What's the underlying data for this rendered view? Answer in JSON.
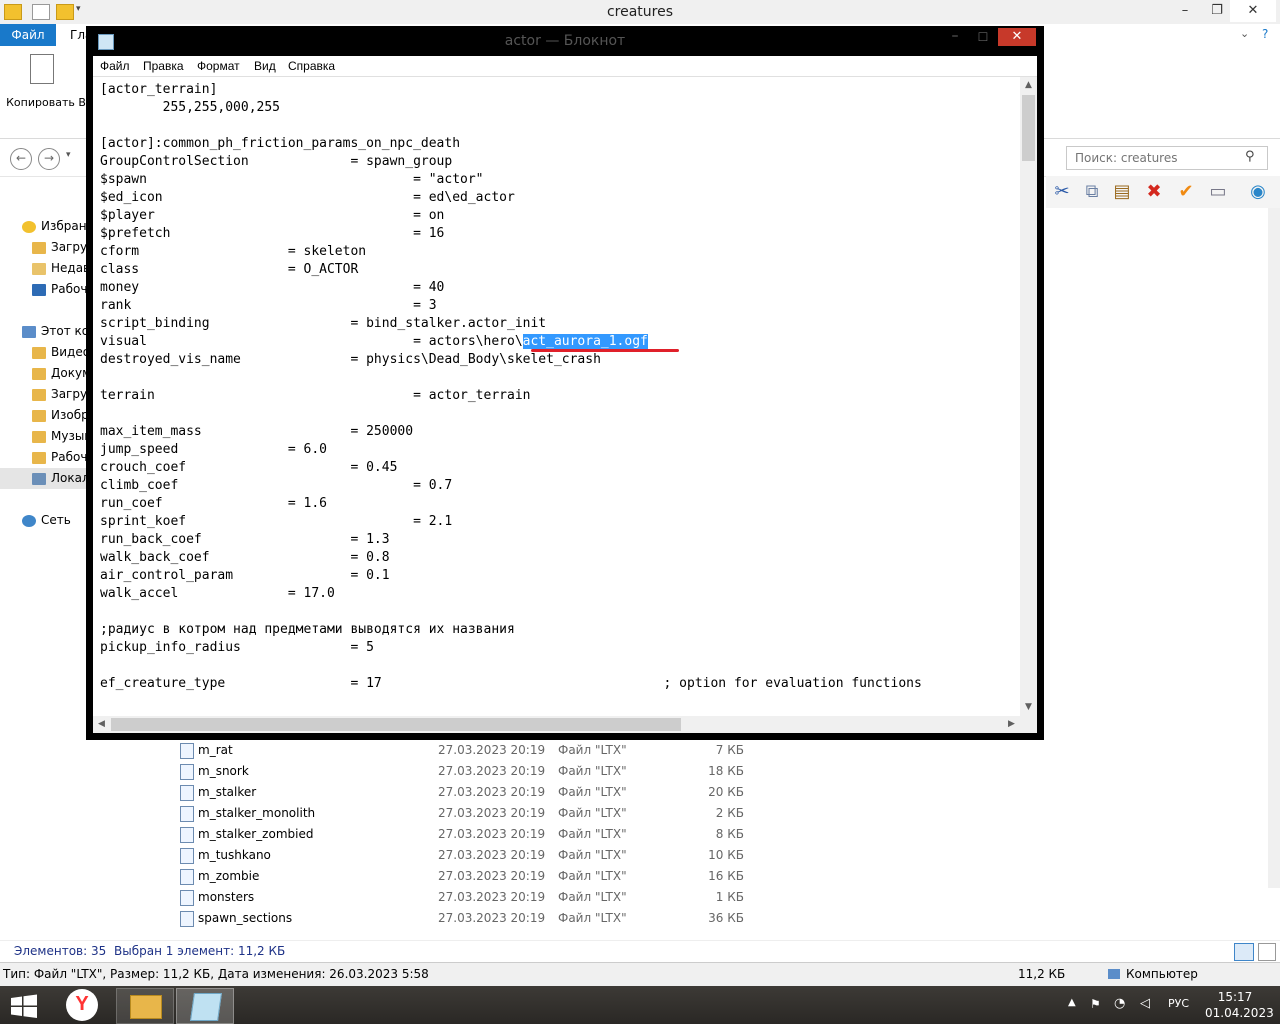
{
  "explorer": {
    "title": "creatures",
    "ribbon_tabs": [
      "Файл",
      "Гла"
    ],
    "copy_label": "Копировать В",
    "search_placeholder": "Поиск: creatures",
    "sidebar": [
      {
        "label": "Избранн",
        "color": "#f2c12e"
      },
      {
        "label": "Загруз",
        "color": "#e8b64a"
      },
      {
        "label": "Недав",
        "color": "#e9c36a"
      },
      {
        "label": "Рабоч",
        "color": "#2d6bb5"
      },
      {
        "label": "Этот ком",
        "color": "#5b8dc9"
      },
      {
        "label": "Видео",
        "color": "#e8b64a"
      },
      {
        "label": "Докум",
        "color": "#e8b64a"
      },
      {
        "label": "Загруз",
        "color": "#e8b64a"
      },
      {
        "label": "Изобр",
        "color": "#e8b64a"
      },
      {
        "label": "Музык",
        "color": "#e8b64a"
      },
      {
        "label": "Рабоч",
        "color": "#e8b64a"
      },
      {
        "label": "Локал",
        "color": "#6b8fb8"
      },
      {
        "label": "Сеть",
        "color": "#3f86c9"
      }
    ],
    "files": [
      {
        "name": "m_rat",
        "date": "27.03.2023 20:19",
        "type": "Файл \"LTX\"",
        "size": "7 КБ"
      },
      {
        "name": "m_snork",
        "date": "27.03.2023 20:19",
        "type": "Файл \"LTX\"",
        "size": "18 КБ"
      },
      {
        "name": "m_stalker",
        "date": "27.03.2023 20:19",
        "type": "Файл \"LTX\"",
        "size": "20 КБ"
      },
      {
        "name": "m_stalker_monolith",
        "date": "27.03.2023 20:19",
        "type": "Файл \"LTX\"",
        "size": "2 КБ"
      },
      {
        "name": "m_stalker_zombied",
        "date": "27.03.2023 20:19",
        "type": "Файл \"LTX\"",
        "size": "8 КБ"
      },
      {
        "name": "m_tushkano",
        "date": "27.03.2023 20:19",
        "type": "Файл \"LTX\"",
        "size": "10 КБ"
      },
      {
        "name": "m_zombie",
        "date": "27.03.2023 20:19",
        "type": "Файл \"LTX\"",
        "size": "16 КБ"
      },
      {
        "name": "monsters",
        "date": "27.03.2023 20:19",
        "type": "Файл \"LTX\"",
        "size": "1 КБ"
      },
      {
        "name": "spawn_sections",
        "date": "27.03.2023 20:19",
        "type": "Файл \"LTX\"",
        "size": "36 КБ"
      }
    ],
    "status": {
      "count": "Элементов: 35",
      "selected": "Выбран 1 элемент: 11,2 КБ"
    },
    "info": {
      "details": "Тип: Файл \"LTX\", Размер: 11,2 КБ, Дата изменения: 26.03.2023 5:58",
      "size": "11,2 КБ",
      "location": "Компьютер"
    }
  },
  "notepad": {
    "title": "actor — Блокнот",
    "menu": [
      "Файл",
      "Правка",
      "Формат",
      "Вид",
      "Справка"
    ],
    "text_before_selection": "[actor_terrain]\n        255,255,000,255\n\n[actor]:common_ph_friction_params_on_npc_death\nGroupControlSection             = spawn_group\n$spawn                                  = \"actor\"\n$ed_icon                                = ed\\ed_actor\n$player                                 = on\n$prefetch                               = 16\ncform                   = skeleton\nclass                   = O_ACTOR\nmoney                                   = 40\nrank                                    = 3\nscript_binding                  = bind_stalker.actor_init\nvisual                                  = actors\\hero\\",
    "selected_text": "act_aurora_1.ogf",
    "text_after_selection": "\ndestroyed_vis_name              = physics\\Dead_Body\\skelet_crash\n\nterrain                                 = actor_terrain\n\nmax_item_mass                   = 250000\njump_speed              = 6.0\ncrouch_coef                     = 0.45\nclimb_coef                              = 0.7\nrun_coef                = 1.6\nsprint_koef                             = 2.1\nrun_back_coef                   = 1.3\nwalk_back_coef                  = 0.8\nair_control_param               = 0.1\nwalk_accel              = 17.0\n\n;радиус в котром над предметами выводятся их названия\npickup_info_radius              = 5\n\nef_creature_type                = 17                                    ; option for evaluation functions"
  },
  "taskbar": {
    "time": "15:17",
    "date": "01.04.2023",
    "language": "РУС",
    "yandex_letter": "Y"
  },
  "colors": {
    "accent": "#1979ca",
    "selection": "#3399ff",
    "close_red": "#c7392a",
    "underline_red": "#e0202a"
  }
}
